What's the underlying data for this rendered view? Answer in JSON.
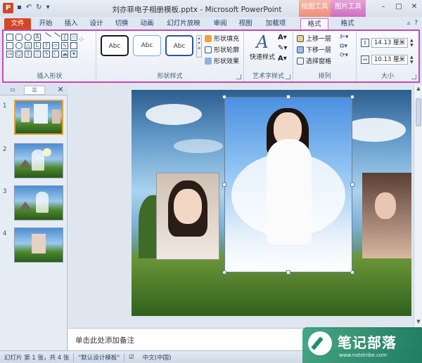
{
  "window": {
    "title": "刘亦菲电子相册模板.pptx - Microsoft PowerPoint",
    "app_letter": "P",
    "ctx_drawing_tools": "绘图工具",
    "ctx_picture_tools": "图片工具"
  },
  "tabs": [
    {
      "label": "文件",
      "active": false
    },
    {
      "label": "开始",
      "active": false
    },
    {
      "label": "插入",
      "active": false
    },
    {
      "label": "设计",
      "active": false
    },
    {
      "label": "切换",
      "active": false
    },
    {
      "label": "动画",
      "active": false
    },
    {
      "label": "幻灯片放映",
      "active": false
    },
    {
      "label": "审阅",
      "active": false
    },
    {
      "label": "视图",
      "active": false
    },
    {
      "label": "加载项",
      "active": false
    },
    {
      "label": "格式",
      "active": true
    },
    {
      "label": "格式",
      "active": false
    }
  ],
  "ribbon": {
    "insert_shapes_label": "插入形状",
    "shape_styles_label": "形状样式",
    "style_gallery": [
      "Abc",
      "Abc",
      "Abc"
    ],
    "shape_fill": "形状填充",
    "shape_outline": "形状轮廓",
    "shape_effects": "形状效果",
    "wordart_label": "艺术字样式",
    "quick_styles": "快速样式",
    "arrange_label": "排列",
    "bring_forward": "上移一层",
    "send_backward": "下移一层",
    "selection_pane": "选择窗格",
    "size_label": "大小",
    "height_value": "14.13 厘米",
    "width_value": "10.13 厘米"
  },
  "panel": {
    "tab_slides": "",
    "slides": [
      {
        "num": "1",
        "selected": true
      },
      {
        "num": "2",
        "selected": false
      },
      {
        "num": "3",
        "selected": false
      },
      {
        "num": "4",
        "selected": false
      }
    ]
  },
  "notes": {
    "placeholder": "单击此处添加备注"
  },
  "status": {
    "slide_info": "幻灯片 第 1 张，共 4 张",
    "theme": "\"默认设计模板\"",
    "language": "中文(中国)"
  },
  "watermark": {
    "text": "笔记部落",
    "url": "www.notetribe.com"
  },
  "colors": {
    "file_tab": "#d24726",
    "context_drawing": "#ee8d7a",
    "context_picture": "#cf6cc0",
    "ribbon_highlight": "#c34ab5"
  }
}
